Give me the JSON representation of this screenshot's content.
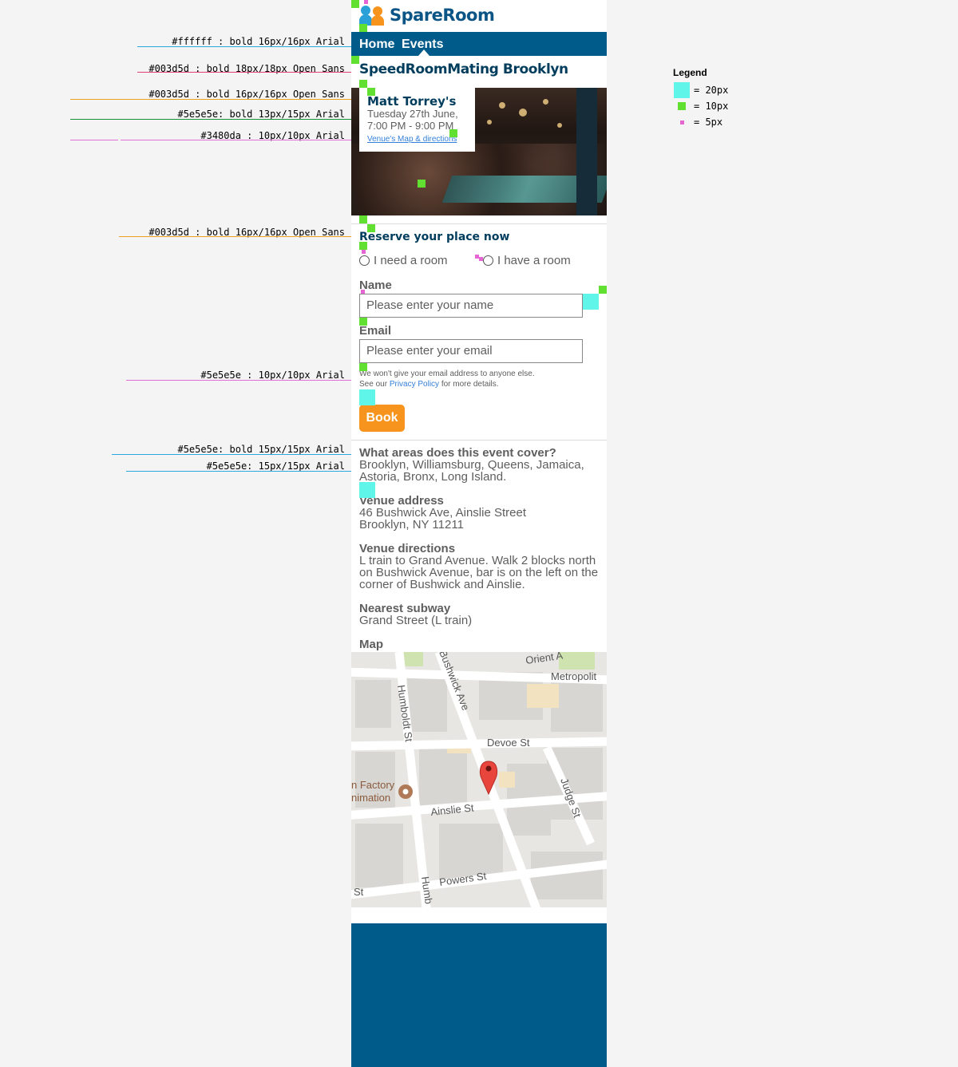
{
  "colors": {
    "brand_dark": "#003d5d",
    "nav_bg": "#005a8a",
    "text_grey": "#5e5e5e",
    "link_blue": "#3480da",
    "button_orange": "#f7941d",
    "marker_cyan": "#5ff5e8",
    "marker_green": "#62e031",
    "marker_pink": "#e565d4"
  },
  "annotations": [
    {
      "label": "#ffffff : bold 16px/16px Arial",
      "color": "#2aa8e0"
    },
    {
      "label": "#003d5d : bold 18px/18px Open Sans",
      "color": "#e0407a"
    },
    {
      "label": "#003d5d : bold 16px/16px Open Sans",
      "color": "#f0a020"
    },
    {
      "label": "#5e5e5e: bold 13px/15px Arial",
      "color": "#1a8f3a"
    },
    {
      "label": "#3480da : 10px/10px Arial",
      "color": "#e070d8"
    },
    {
      "label": "#003d5d : bold 16px/16px Open Sans",
      "color": "#f0a020"
    },
    {
      "label": "#5e5e5e : 10px/10px Arial",
      "color": "#e070d8"
    },
    {
      "label": "#5e5e5e: bold 15px/15px Arial",
      "color": "#2aa8e0"
    },
    {
      "label": "#5e5e5e: 15px/15px Arial",
      "color": "#2aa8e0"
    }
  ],
  "legend": {
    "title": "Legend",
    "items": [
      {
        "label": "= 20px",
        "color": "#5ff5e8"
      },
      {
        "label": "= 10px",
        "color": "#62e031"
      },
      {
        "label": "= 5px",
        "color": "#e565d4"
      }
    ]
  },
  "logo": {
    "text": "SpareRoom",
    "icon": "people-logo-icon"
  },
  "nav": {
    "home": "Home",
    "events": "Events"
  },
  "event": {
    "title": "SpeedRoomMating Brooklyn",
    "venue_name": "Matt Torrey's",
    "date": "Tuesday 27th June,",
    "time": "7:00 PM - 9:00 PM",
    "map_link": "Venue's Map & directions"
  },
  "reserve": {
    "title": "Reserve your place now",
    "option_need": "I need a room",
    "option_have": "I have a room",
    "name_label": "Name",
    "name_placeholder": "Please enter your name",
    "email_label": "Email",
    "email_placeholder": "Please enter your email",
    "note_line1": "We won't give your email address to anyone else.",
    "note_see": "See our",
    "note_link": "Privacy Policy",
    "note_tail": "for more details.",
    "book_label": "Book"
  },
  "info": {
    "areas_title": "What areas does this event cover?",
    "areas_line1": "Brooklyn, Williamsburg, Queens, Jamaica,",
    "areas_line2": "Astoria, Bronx, Long Island.",
    "address_title": "Venue address",
    "address_line1": "46 Bushwick Ave, Ainslie Street",
    "address_line2": "Brooklyn, NY 11211",
    "directions_title": "Venue directions",
    "directions_line1": "L train to Grand Avenue. Walk 2 blocks north",
    "directions_line2": "on Bushwick Avenue, bar is on the left on the",
    "directions_line3": "corner of Bushwick and Ainslie.",
    "subway_title": "Nearest subway",
    "subway_value": "Grand Street (L train)",
    "map_title": "Map"
  },
  "map": {
    "streets": {
      "bushwick": "Bushwick Ave",
      "humboldt": "Humboldt St",
      "humboldt_short": "Humb",
      "devoe": "Devoe St",
      "judge": "Judge St",
      "ainslie": "Ainslie St",
      "powers": "Powers St",
      "orient": "Orient A",
      "metropolitan": "Metropolit",
      "st_left": "St"
    },
    "poi_line1": "n Factory",
    "poi_line2": "nimation",
    "pin_icon": "map-pin-icon"
  }
}
